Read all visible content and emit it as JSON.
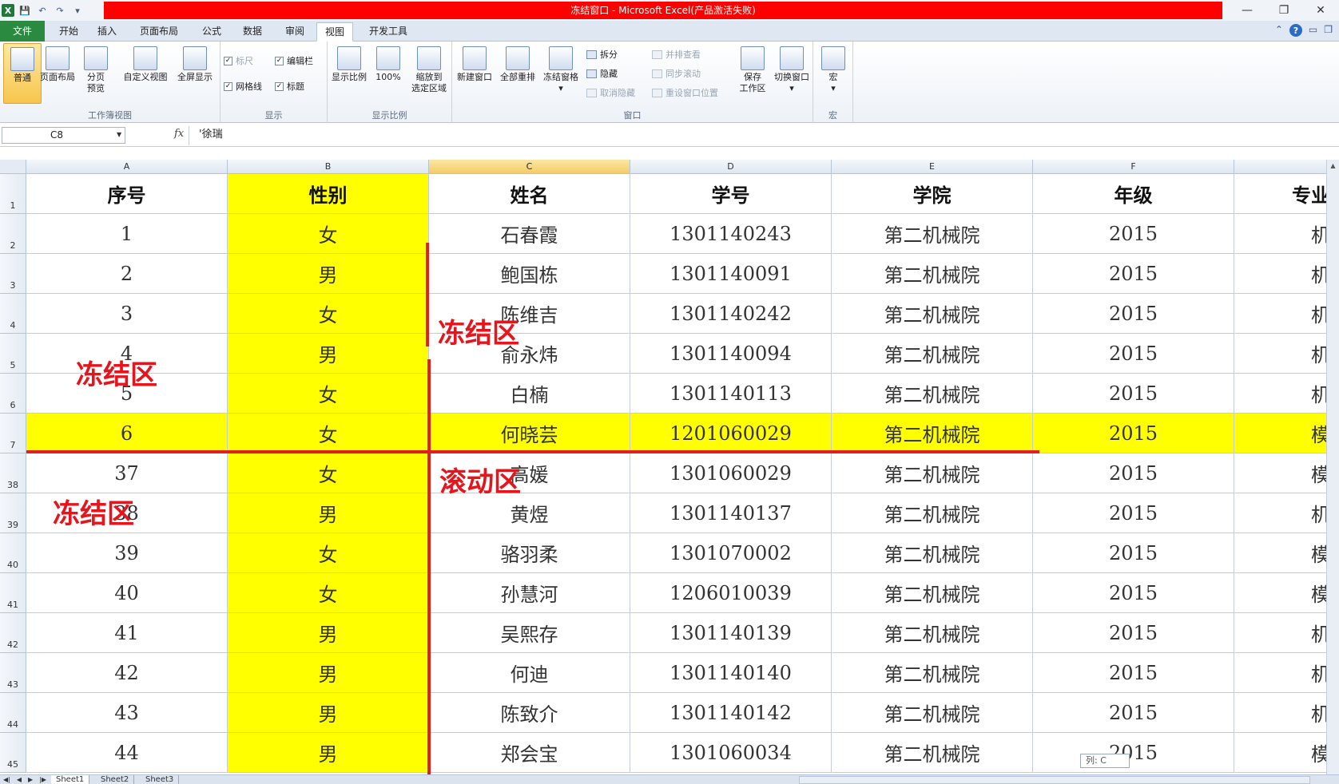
{
  "title": "冻结窗口 - Microsoft Excel(产品激活失败)",
  "tabs": [
    "文件",
    "开始",
    "插入",
    "页面布局",
    "公式",
    "数据",
    "审阅",
    "视图",
    "开发工具"
  ],
  "ribbon": {
    "workbook_views": {
      "label": "工作簿视图",
      "normal": "普通",
      "page_layout": "页面布局",
      "page_break": "分页\n预览",
      "custom_views": "自定义视图",
      "full_screen": "全屏显示"
    },
    "show": {
      "label": "显示",
      "ruler": "标尺",
      "formula_bar": "编辑栏",
      "gridlines": "网格线",
      "headings": "标题"
    },
    "zoom": {
      "label": "显示比例",
      "zoom": "显示比例",
      "hundred": "100%",
      "zoom_selection": "缩放到\n选定区域"
    },
    "window": {
      "label": "窗口",
      "new_window": "新建窗口",
      "arrange_all": "全部重排",
      "freeze_panes": "冻结窗格",
      "split": "拆分",
      "hide": "隐藏",
      "unhide": "取消隐藏",
      "side_by_side": "并排查看",
      "sync_scroll": "同步滚动",
      "reset_position": "重设窗口位置",
      "save_workspace": "保存\n工作区",
      "switch_windows": "切换窗口"
    },
    "macros": {
      "label": "宏",
      "macros": "宏"
    }
  },
  "formula_bar": {
    "name_box": "C8",
    "fx": "fx",
    "content": "'徐瑞"
  },
  "columns": [
    "A",
    "B",
    "C",
    "D",
    "E",
    "F",
    ""
  ],
  "rows": [
    {
      "num": "1",
      "cells": [
        "序号",
        "性别",
        "姓名",
        "学号",
        "学院",
        "年级",
        "专业"
      ]
    },
    {
      "num": "2",
      "cells": [
        "1",
        "女",
        "石春霞",
        "1301140243",
        "第二机械院",
        "2015",
        "机"
      ]
    },
    {
      "num": "3",
      "cells": [
        "2",
        "男",
        "鲍国栋",
        "1301140091",
        "第二机械院",
        "2015",
        "机"
      ]
    },
    {
      "num": "4",
      "cells": [
        "3",
        "女",
        "陈维吉",
        "1301140242",
        "第二机械院",
        "2015",
        "机"
      ]
    },
    {
      "num": "5",
      "cells": [
        "4",
        "男",
        "俞永炜",
        "1301140094",
        "第二机械院",
        "2015",
        "机"
      ]
    },
    {
      "num": "6",
      "cells": [
        "5",
        "女",
        "白楠",
        "1301140113",
        "第二机械院",
        "2015",
        "机"
      ]
    },
    {
      "num": "7",
      "cells": [
        "6",
        "女",
        "何晓芸",
        "1201060029",
        "第二机械院",
        "2015",
        "模"
      ]
    },
    {
      "num": "38",
      "cells": [
        "37",
        "女",
        "高媛",
        "1301060029",
        "第二机械院",
        "2015",
        "模"
      ]
    },
    {
      "num": "39",
      "cells": [
        "38",
        "男",
        "黄煜",
        "1301140137",
        "第二机械院",
        "2015",
        "机"
      ]
    },
    {
      "num": "40",
      "cells": [
        "39",
        "女",
        "骆羽柔",
        "1301070002",
        "第二机械院",
        "2015",
        "模"
      ]
    },
    {
      "num": "41",
      "cells": [
        "40",
        "女",
        "孙慧河",
        "1206010039",
        "第二机械院",
        "2015",
        "模"
      ]
    },
    {
      "num": "42",
      "cells": [
        "41",
        "男",
        "吴熙存",
        "1301140139",
        "第二机械院",
        "2015",
        "机"
      ]
    },
    {
      "num": "43",
      "cells": [
        "42",
        "男",
        "何迪",
        "1301140140",
        "第二机械院",
        "2015",
        "机"
      ]
    },
    {
      "num": "44",
      "cells": [
        "43",
        "男",
        "陈致介",
        "1301140142",
        "第二机械院",
        "2015",
        "机"
      ]
    },
    {
      "num": "45",
      "cells": [
        "44",
        "男",
        "郑会宝",
        "1301060034",
        "第二机械院",
        "2015",
        "模"
      ]
    }
  ],
  "annotations": {
    "frozen_top": "冻结区",
    "frozen_left": "冻结区",
    "frozen_bottom_left": "冻结区",
    "scroll": "滚动区"
  },
  "sheets": [
    "Sheet1",
    "Sheet2",
    "Sheet3"
  ],
  "status_tooltip": "列: C",
  "colors": {
    "highlight": "#ffff00",
    "annotation": "#e8141c",
    "title_bar": "#ff0000",
    "file_tab": "#2a8a3f"
  }
}
